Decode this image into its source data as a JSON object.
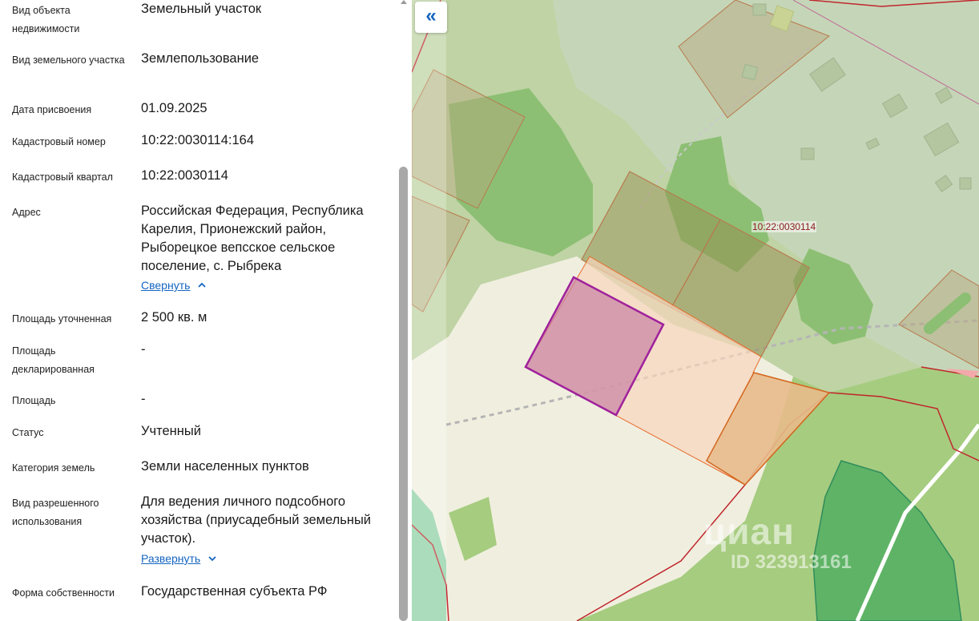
{
  "fields": [
    {
      "label": "Вид объекта недвижимости",
      "value": "Земельный участок"
    },
    {
      "label": "Вид земельного участка",
      "value": "Землепользование"
    },
    {
      "label": "Дата присвоения",
      "value": "01.09.2025"
    },
    {
      "label": "Кадастровый номер",
      "value": "10:22:0030114:164"
    },
    {
      "label": "Кадастровый квартал",
      "value": "10:22:0030114"
    },
    {
      "label": "Адрес",
      "value": "Российская Федерация, Республика Карелия, Прионежский район, Рыборецкое вепсское сельское поселение, с. Рыбрека",
      "toggle": "Свернуть"
    },
    {
      "label": "Площадь уточненная",
      "value": "2 500 кв. м"
    },
    {
      "label": "Площадь декларированная",
      "value": "-"
    },
    {
      "label": "Площадь",
      "value": "-"
    },
    {
      "label": "Статус",
      "value": "Учтенный"
    },
    {
      "label": "Категория земель",
      "value": "Земли населенных пунктов"
    },
    {
      "label": "Вид разрешенного использования",
      "value": "Для ведения личного подсобного хозяйства (приусадебный земельный участок).",
      "toggle": "Развернуть"
    },
    {
      "label": "Форма собственности",
      "value": "Государственная субъекта РФ"
    }
  ],
  "map": {
    "collapse_icon": "double-chevron-left-icon",
    "quarter_label": "10:22:0030114",
    "watermark_brand": "циан",
    "watermark_id": "ID 323913161",
    "colors": {
      "selected_parcel": "#a0219c",
      "parcel_border": "#e8692b",
      "boundary": "#c0262d",
      "forest": "#8cbf73",
      "dense_forest": "#5fb366",
      "built_up": "#f0efdf",
      "accent": "#1565c0"
    }
  }
}
